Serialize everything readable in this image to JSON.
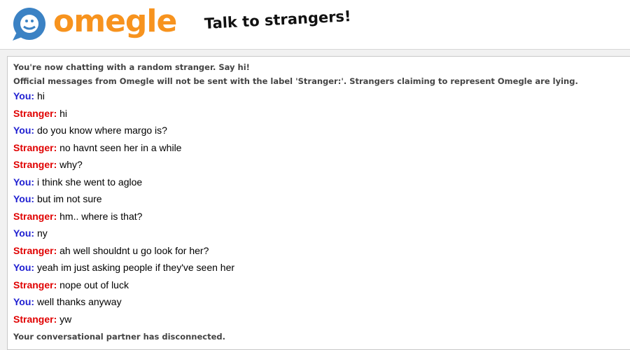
{
  "header": {
    "logo_text": "omegle",
    "tagline": "Talk to strangers!",
    "brand_orange": "#f7931e",
    "brand_blue": "#3b82c4"
  },
  "chat": {
    "intro": "You're now chatting with a random stranger. Say hi!",
    "notice": "Official messages from Omegle will not be sent with the label 'Stranger:'. Strangers claiming to represent Omegle are lying.",
    "messages": [
      {
        "speaker": "You:",
        "role": "you",
        "text": "hi"
      },
      {
        "speaker": "Stranger:",
        "role": "stranger",
        "text": "hi"
      },
      {
        "speaker": "You:",
        "role": "you",
        "text": "do you know where margo is?"
      },
      {
        "speaker": "Stranger:",
        "role": "stranger",
        "text": "no havnt seen her in a while"
      },
      {
        "speaker": "Stranger:",
        "role": "stranger",
        "text": "why?"
      },
      {
        "speaker": "You:",
        "role": "you",
        "text": "i think she went to agloe"
      },
      {
        "speaker": "You:",
        "role": "you",
        "text": "but im not sure"
      },
      {
        "speaker": "Stranger:",
        "role": "stranger",
        "text": "hm.. where is that?"
      },
      {
        "speaker": "You:",
        "role": "you",
        "text": "ny"
      },
      {
        "speaker": "Stranger:",
        "role": "stranger",
        "text": "ah well shouldnt u go look for her?"
      },
      {
        "speaker": "You:",
        "role": "you",
        "text": "yeah im just asking people if they've seen her"
      },
      {
        "speaker": "Stranger:",
        "role": "stranger",
        "text": "nope out of luck"
      },
      {
        "speaker": "You:",
        "role": "you",
        "text": "well thanks anyway"
      },
      {
        "speaker": "Stranger:",
        "role": "stranger",
        "text": "yw"
      }
    ],
    "disconnect": "Your conversational partner has disconnected.",
    "colors": {
      "you": "#1f1fd1",
      "stranger": "#e00000"
    }
  }
}
